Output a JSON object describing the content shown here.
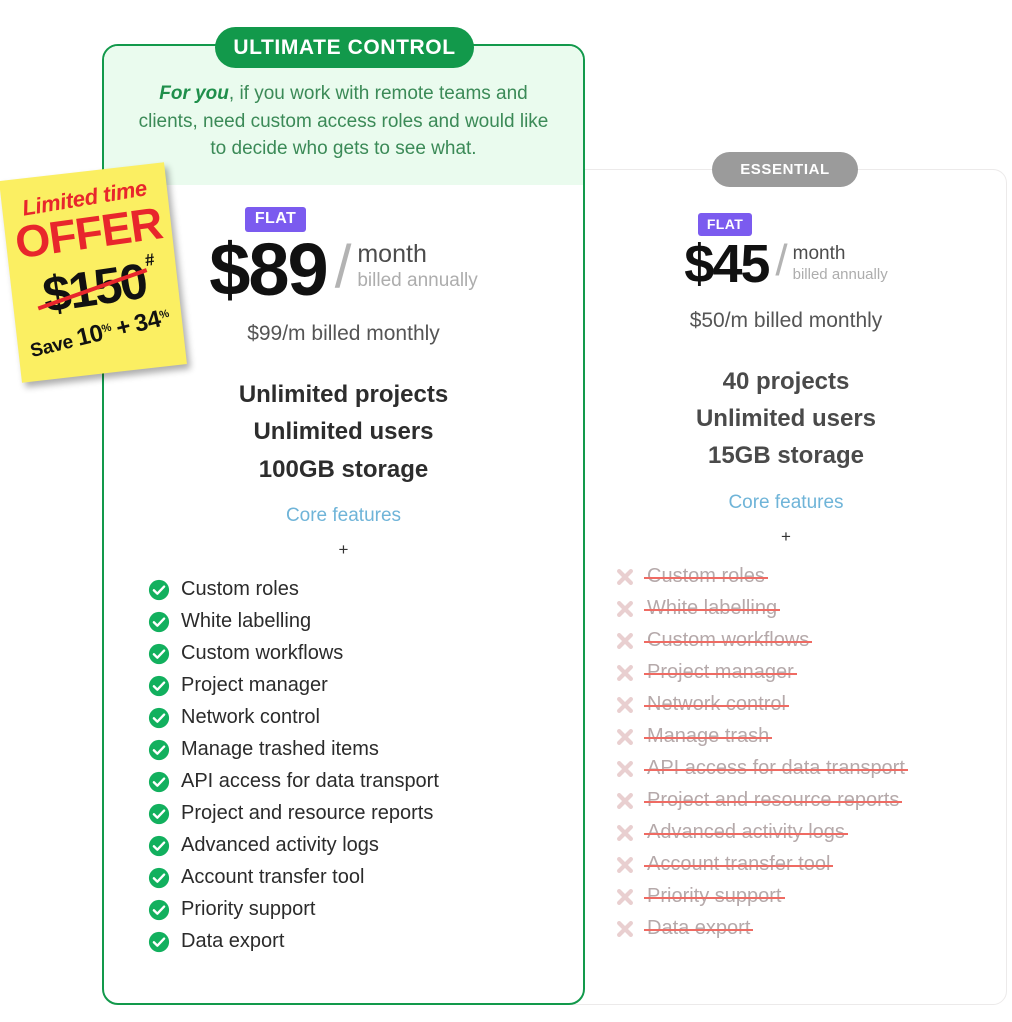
{
  "offer_sticker": {
    "limited_text": "Limited time",
    "offer_word": "OFFER",
    "old_price": "$150",
    "hash_mark": "#",
    "save_prefix": "Save",
    "save_first": "10",
    "percent_1": "%",
    "plus": "+",
    "save_second": "34",
    "percent_2": "%",
    "bg_color": "#FBEF62",
    "accent_color": "#E8262C"
  },
  "plans": [
    {
      "id": "ultimate",
      "ribbon_label": "ULTIMATE CONTROL",
      "ribbon_color": "#12994B",
      "tagline_lead": "For you",
      "tagline_rest": ", if you work with remote teams and clients, need custom access roles and would like to decide who gets to see what.",
      "flat_badge": "FLAT",
      "flat_badge_color": "#7B5BEF",
      "price": "$89",
      "slash": "/",
      "per_unit": "month",
      "billed_note": "billed annually",
      "monthly_note": "$99/m billed monthly",
      "specs": [
        "Unlimited projects",
        "Unlimited users",
        "100GB storage"
      ],
      "core_features_link": "Core features",
      "plus_separator": "+",
      "features": [
        {
          "label": "Custom roles",
          "included": true
        },
        {
          "label": "White labelling",
          "included": true
        },
        {
          "label": "Custom workflows",
          "included": true
        },
        {
          "label": "Project manager",
          "included": true
        },
        {
          "label": "Network control",
          "included": true
        },
        {
          "label": "Manage trashed items",
          "included": true
        },
        {
          "label": "API access for data transport",
          "included": true
        },
        {
          "label": "Project and resource reports",
          "included": true
        },
        {
          "label": "Advanced activity logs",
          "included": true
        },
        {
          "label": "Account transfer tool",
          "included": true
        },
        {
          "label": "Priority support",
          "included": true
        },
        {
          "label": "Data export",
          "included": true
        }
      ]
    },
    {
      "id": "essential",
      "ribbon_label": "ESSENTIAL",
      "ribbon_color": "#9B9B9B",
      "flat_badge": "FLAT",
      "flat_badge_color": "#7B5BEF",
      "price": "$45",
      "slash": "/",
      "per_unit": "month",
      "billed_note": "billed annually",
      "monthly_note": "$50/m billed monthly",
      "specs": [
        "40 projects",
        "Unlimited users",
        "15GB storage"
      ],
      "core_features_link": "Core features",
      "plus_separator": "+",
      "features": [
        {
          "label": "Custom roles",
          "included": false
        },
        {
          "label": "White labelling",
          "included": false
        },
        {
          "label": "Custom workflows",
          "included": false
        },
        {
          "label": "Project manager",
          "included": false
        },
        {
          "label": "Network control",
          "included": false
        },
        {
          "label": "Manage trash",
          "included": false
        },
        {
          "label": "API access for data transport",
          "included": false
        },
        {
          "label": "Project and resource reports",
          "included": false
        },
        {
          "label": "Advanced activity logs",
          "included": false
        },
        {
          "label": "Account transfer tool",
          "included": false
        },
        {
          "label": "Priority support",
          "included": false
        },
        {
          "label": "Data export",
          "included": false
        }
      ]
    }
  ]
}
